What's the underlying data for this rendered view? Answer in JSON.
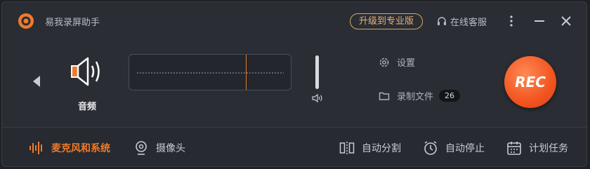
{
  "app": {
    "title": "易我录屏助手"
  },
  "header": {
    "upgrade_label": "升级到专业版",
    "support_label": "在线客服"
  },
  "source": {
    "label": "音频"
  },
  "sidebar": {
    "settings_label": "设置",
    "recordings_label": "录制文件",
    "recordings_count": "26"
  },
  "rec": {
    "label": "REC"
  },
  "bottom": {
    "mic_system_label": "麦克风和系统",
    "camera_label": "摄像头",
    "auto_split_label": "自动分割",
    "auto_stop_label": "自动停止",
    "schedule_label": "计划任务"
  },
  "colors": {
    "accent": "#f07a2c",
    "rec": "#f2541f",
    "upgrade": "#e7b27a"
  }
}
